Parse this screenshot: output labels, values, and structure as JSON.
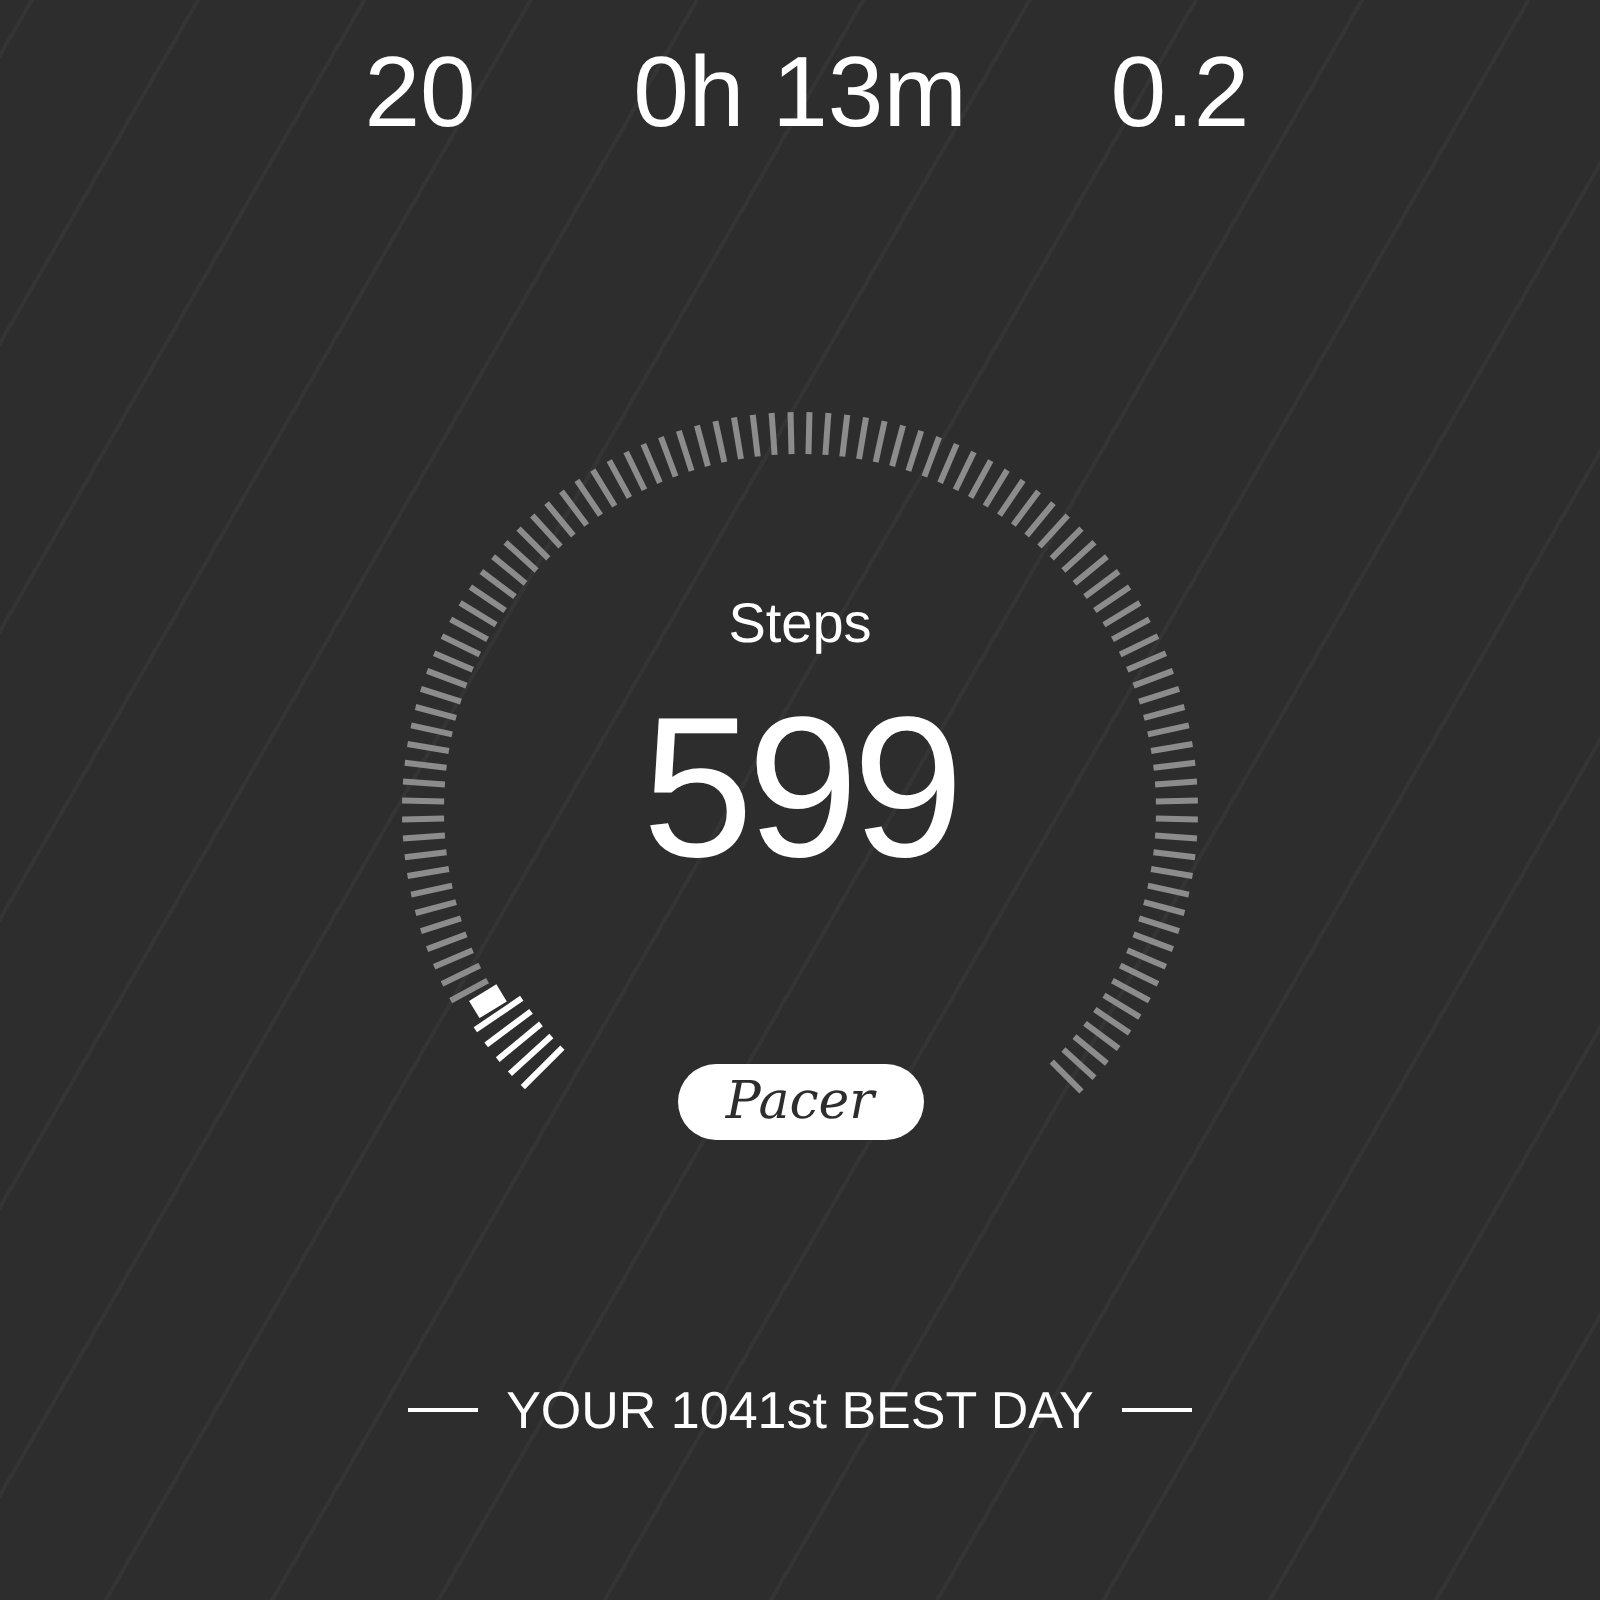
{
  "stats": [
    {
      "value": "20"
    },
    {
      "value": "0h 13m"
    },
    {
      "value": "0.2"
    }
  ],
  "gauge": {
    "label": "Steps",
    "value": "599",
    "logo": "Pacer"
  },
  "footer": "YOUR 1041st BEST DAY"
}
